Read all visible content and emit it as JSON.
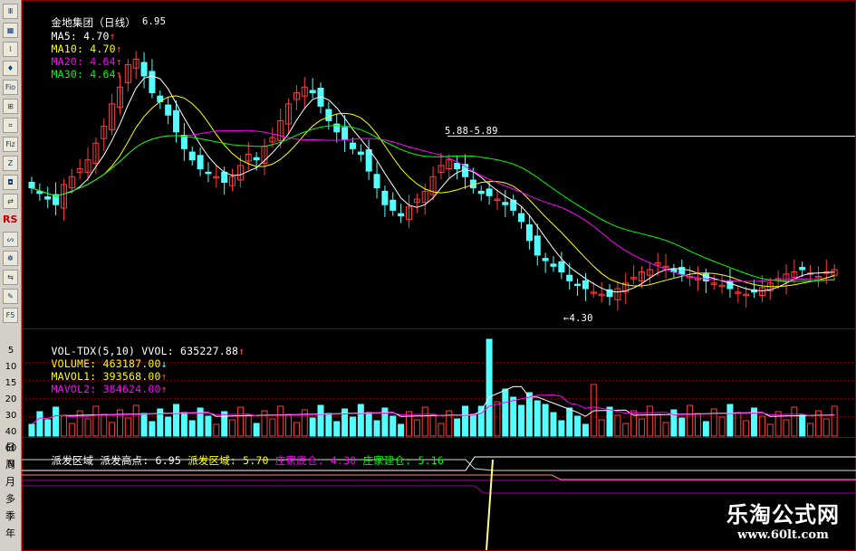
{
  "toolbar": {
    "buttons": [
      "Ⅲ",
      "▦",
      "⌇",
      "♦",
      "Fio",
      "⊞",
      "⌗",
      "Fiz",
      "Z",
      "◘",
      "⇄",
      "RSI",
      "ᔕ",
      "☸",
      "⇆",
      "✎",
      "F5"
    ],
    "timeframes": [
      "日",
      "周",
      "月",
      "多",
      "季",
      "年"
    ],
    "volume_scale": [
      "5",
      "10",
      "15",
      "20",
      "30",
      "40",
      "60",
      "N"
    ]
  },
  "header": {
    "stock": "金地集团（日线）",
    "ma5_label": "MA5: 4.70",
    "ma10_label": "MA10: 4.70",
    "ma20_label": "MA20: 4.64",
    "ma30_label": "MA30: 4.64",
    "arrow_up": "↑"
  },
  "volume_header": {
    "indicator": "VOL-TDX(5,10)",
    "vvol_label": "VVOL: 635227.88",
    "volume_label": "VOLUME: 463187.00",
    "mavol1_label": "MAVOL1: 393568.00",
    "mavol2_label": "MAVOL2: 384624.00",
    "arrow_up": "↑",
    "arrow_down": "↓"
  },
  "indicator_header": {
    "name": "派发区域",
    "high_label": "派发高点: 6.95",
    "zone_label": "派发区域: 5.70",
    "bottom_label": "庄家底仓: 4.30",
    "build_label": "庄家建仓: 5.16"
  },
  "annotations": {
    "high": "6.95",
    "mid": "5.88-5.89",
    "low": "←4.30"
  },
  "watermark": {
    "title": "乐淘公式网",
    "url": "www.60lt.com"
  },
  "colors": {
    "up": "#ff3c3c",
    "down": "#54ffff",
    "ma5": "#ffffff",
    "ma10": "#ffff00",
    "ma20": "#ff00ff",
    "ma30": "#00ff00",
    "grid": "#8b0000"
  },
  "chart_data": {
    "type": "candlestick",
    "y_range": [
      4.3,
      6.95
    ],
    "closes": [
      5.45,
      5.4,
      5.35,
      5.3,
      5.48,
      5.55,
      5.62,
      5.7,
      5.85,
      6.0,
      6.2,
      6.35,
      6.55,
      6.6,
      6.45,
      6.3,
      6.22,
      6.1,
      5.95,
      5.8,
      5.7,
      5.62,
      5.58,
      5.55,
      5.5,
      5.55,
      5.65,
      5.75,
      5.7,
      5.82,
      5.9,
      6.05,
      6.2,
      6.3,
      6.35,
      6.3,
      6.18,
      6.05,
      5.95,
      5.88,
      5.8,
      5.75,
      5.6,
      5.45,
      5.3,
      5.25,
      5.2,
      5.28,
      5.35,
      5.42,
      5.55,
      5.65,
      5.7,
      5.62,
      5.55,
      5.45,
      5.4,
      5.38,
      5.35,
      5.3,
      5.25,
      5.15,
      4.98,
      4.85,
      4.8,
      4.75,
      4.7,
      4.62,
      4.58,
      4.55,
      4.52,
      4.5,
      4.48,
      4.55,
      4.6,
      4.65,
      4.7,
      4.72,
      4.78,
      4.75,
      4.7,
      4.68,
      4.66,
      4.64,
      4.62,
      4.6,
      4.58,
      4.55,
      4.52,
      4.5,
      4.52,
      4.56,
      4.6,
      4.64,
      4.68,
      4.7,
      4.72,
      4.69,
      4.66,
      4.7,
      4.72
    ]
  }
}
